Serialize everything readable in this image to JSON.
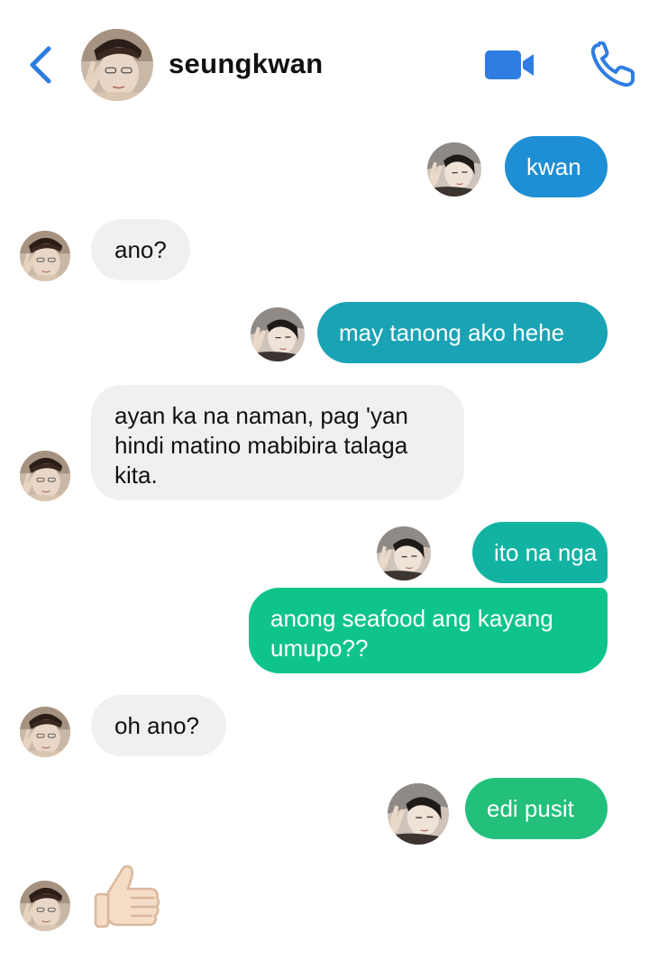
{
  "header": {
    "contact_name": "seungkwan",
    "back_icon": "chevron-left-icon",
    "video_icon": "video-camera-icon",
    "phone_icon": "phone-icon"
  },
  "colors": {
    "accent": "#2f7de1",
    "incoming_bubble": "#f0f0f0",
    "outgoing_gradient": [
      "#1e8fd4",
      "#1aa3b5",
      "#13b79c",
      "#0ec48a",
      "#22c07a"
    ]
  },
  "messages": [
    {
      "sender": "me",
      "text": "kwan"
    },
    {
      "sender": "seungkwan",
      "text": "ano?"
    },
    {
      "sender": "me",
      "text": "may tanong ako hehe"
    },
    {
      "sender": "seungkwan",
      "text": "ayan ka na naman, pag 'yan hindi matino mabibira talaga kita."
    },
    {
      "sender": "me",
      "text": "ito na nga"
    },
    {
      "sender": "me",
      "text": "anong seafood ang kayang umupo??"
    },
    {
      "sender": "seungkwan",
      "text": "oh ano?"
    },
    {
      "sender": "me",
      "text": "edi pusit"
    },
    {
      "sender": "seungkwan",
      "emoji": "thumbs-up-icon"
    }
  ]
}
